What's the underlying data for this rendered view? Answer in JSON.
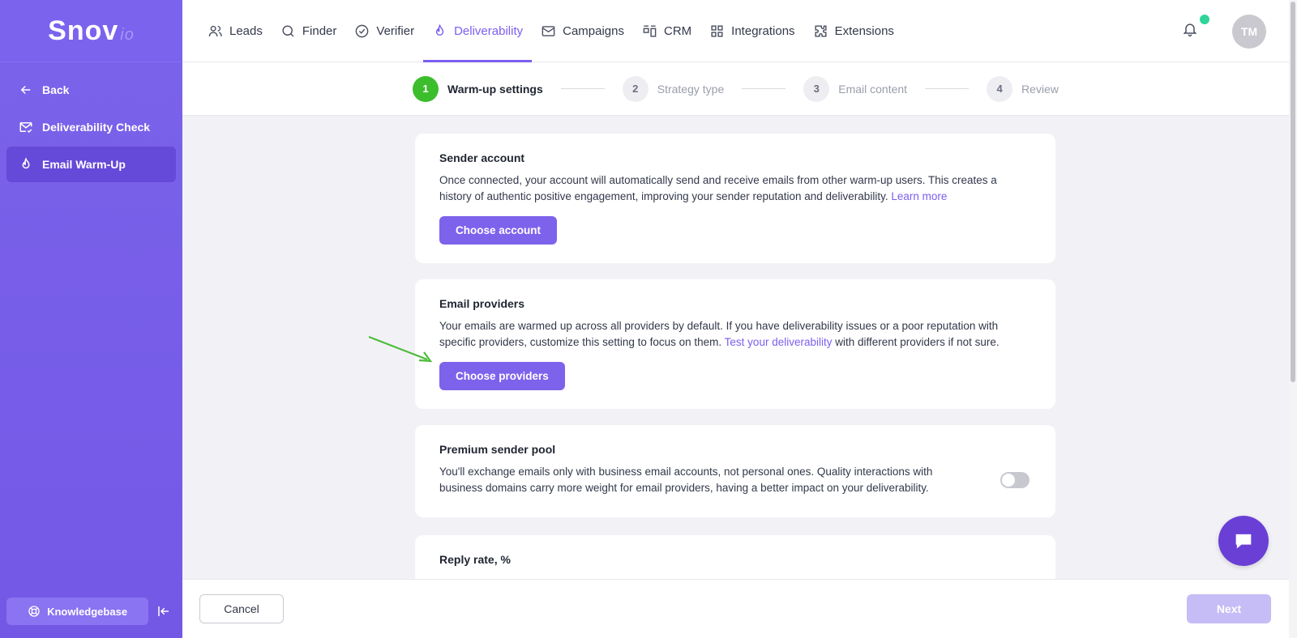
{
  "brand": {
    "name": "Snov",
    "suffix": "io",
    "color": "#7b63ee"
  },
  "sidebar": {
    "items": [
      {
        "label": "Back",
        "icon": "arrow-left-icon"
      },
      {
        "label": "Deliverability Check",
        "icon": "mail-check-icon"
      },
      {
        "label": "Email Warm-Up",
        "icon": "flame-icon",
        "active": true
      }
    ],
    "knowledgebase_label": "Knowledgebase",
    "collapse_icon": "collapse-left-icon"
  },
  "topnav": {
    "items": [
      {
        "label": "Leads",
        "icon": "users-icon"
      },
      {
        "label": "Finder",
        "icon": "search-icon"
      },
      {
        "label": "Verifier",
        "icon": "check-circle-icon"
      },
      {
        "label": "Deliverability",
        "icon": "flame-icon",
        "active": true
      },
      {
        "label": "Campaigns",
        "icon": "envelope-icon"
      },
      {
        "label": "CRM",
        "icon": "crm-icon"
      },
      {
        "label": "Integrations",
        "icon": "grid-icon"
      },
      {
        "label": "Extensions",
        "icon": "puzzle-icon"
      }
    ],
    "avatar_initials": "TM",
    "accent": "#7b5ef0"
  },
  "steps": [
    {
      "num": "1",
      "label": "Warm-up settings",
      "current": true
    },
    {
      "num": "2",
      "label": "Strategy type"
    },
    {
      "num": "3",
      "label": "Email content"
    },
    {
      "num": "4",
      "label": "Review"
    }
  ],
  "cards": {
    "sender": {
      "title": "Sender account",
      "text": "Once connected, your account will automatically send and receive emails from other warm-up users. This creates a history of authentic positive engagement, improving your sender reputation and deliverability.",
      "link": "Learn more",
      "button": "Choose account"
    },
    "providers": {
      "title": "Email providers",
      "text_before": "Your emails are warmed up across all providers by default. If you have deliverability issues or a poor reputation with specific providers, customize this setting to focus on them.",
      "link": "Test your deliverability",
      "text_after": "with different providers if not sure.",
      "button": "Choose providers"
    },
    "premium": {
      "title": "Premium sender pool",
      "text": "You'll exchange emails only with business email accounts, not personal ones. Quality interactions with business domains carry more weight for email providers, having a better impact on your deliverability.",
      "toggle_on": false
    },
    "reply": {
      "title": "Reply rate, %"
    }
  },
  "footer": {
    "cancel": "Cancel",
    "next": "Next"
  },
  "colors": {
    "step_current": "#3cbd2c",
    "primary_button": "#7d62ec",
    "arrow": "#4cbb3a",
    "next_disabled": "#c6bcf6"
  }
}
